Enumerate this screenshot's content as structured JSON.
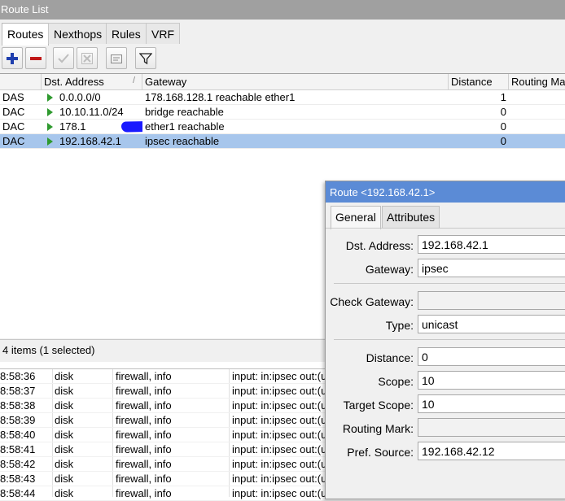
{
  "window": {
    "title": "Route List"
  },
  "tabs": [
    "Routes",
    "Nexthops",
    "Rules",
    "VRF"
  ],
  "toolbar": {
    "buttons": [
      "add-icon",
      "remove-icon",
      "enable-icon",
      "disable-icon",
      "comment-icon",
      "filter-icon"
    ]
  },
  "table": {
    "columns": [
      "",
      "Dst. Address",
      "Gateway",
      "Distance",
      "Routing Ma"
    ],
    "sort_indicator": "/",
    "rows": [
      {
        "flags": "DAS",
        "dst": "0.0.0.0/0",
        "gateway": "178.168.128.1 reachable ether1",
        "distance": "1"
      },
      {
        "flags": "DAC",
        "dst": "10.10.11.0/24",
        "gateway": "bridge reachable",
        "distance": "0"
      },
      {
        "flags": "DAC",
        "dst": "178.1",
        "gateway": "ether1 reachable",
        "distance": "0"
      },
      {
        "flags": "DAC",
        "dst": "192.168.42.1",
        "gateway": "ipsec reachable",
        "distance": "0"
      }
    ]
  },
  "status": {
    "text": "4 items (1 selected)"
  },
  "log": {
    "rows": [
      {
        "time": "8:58:36",
        "buffer": "disk",
        "topics": "firewall, info",
        "message": "input: in:ipsec out:(u"
      },
      {
        "time": "8:58:37",
        "buffer": "disk",
        "topics": "firewall, info",
        "message": "input: in:ipsec out:(u"
      },
      {
        "time": "8:58:38",
        "buffer": "disk",
        "topics": "firewall, info",
        "message": "input: in:ipsec out:(u"
      },
      {
        "time": "8:58:39",
        "buffer": "disk",
        "topics": "firewall, info",
        "message": "input: in:ipsec out:(u"
      },
      {
        "time": "8:58:40",
        "buffer": "disk",
        "topics": "firewall, info",
        "message": "input: in:ipsec out:(u"
      },
      {
        "time": "8:58:41",
        "buffer": "disk",
        "topics": "firewall, info",
        "message": "input: in:ipsec out:(u"
      },
      {
        "time": "8:58:42",
        "buffer": "disk",
        "topics": "firewall, info",
        "message": "input: in:ipsec out:(u"
      },
      {
        "time": "8:58:43",
        "buffer": "disk",
        "topics": "firewall, info",
        "message": "input: in:ipsec out:(u"
      },
      {
        "time": "8:58:44",
        "buffer": "disk",
        "topics": "firewall, info",
        "message": "input: in:ipsec out:(u"
      }
    ]
  },
  "dialog": {
    "title": "Route <192.168.42.1>",
    "tabs": [
      "General",
      "Attributes"
    ],
    "fields": {
      "dst_address": {
        "label": "Dst. Address:",
        "value": "192.168.42.1"
      },
      "gateway": {
        "label": "Gateway:",
        "value": "ipsec"
      },
      "check_gateway": {
        "label": "Check Gateway:",
        "value": ""
      },
      "type": {
        "label": "Type:",
        "value": "unicast"
      },
      "distance": {
        "label": "Distance:",
        "value": "0"
      },
      "scope": {
        "label": "Scope:",
        "value": "10"
      },
      "target_scope": {
        "label": "Target Scope:",
        "value": "10"
      },
      "routing_mark": {
        "label": "Routing Mark:",
        "value": ""
      },
      "pref_source": {
        "label": "Pref. Source:",
        "value": "192.168.42.12"
      }
    }
  },
  "colors": {
    "selected_row": "#a7c6ec",
    "dialog_title": "#5b8bd6",
    "add_icon": "#1f3fae",
    "remove_icon": "#c01818",
    "flag_arrow": "#2f9a2f"
  }
}
